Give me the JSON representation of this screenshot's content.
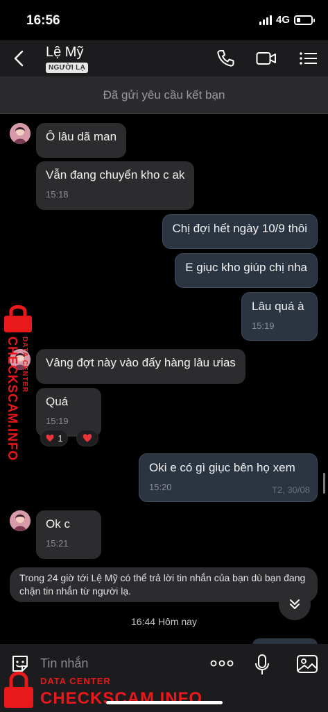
{
  "status": {
    "time": "16:56",
    "network": "4G"
  },
  "header": {
    "name": "Lệ Mỹ",
    "badge": "NGƯỜI LẠ"
  },
  "banner": "Đã gửi yêu cầu kết bạn",
  "messages": [
    {
      "dir": "in",
      "text": "Ô lâu dã man",
      "time": ""
    },
    {
      "dir": "in",
      "text": "Vẫn đang chuyển kho c ak",
      "time": "15:18"
    },
    {
      "dir": "out",
      "text": "Chị đợi hết ngày 10/9 thôi",
      "time": ""
    },
    {
      "dir": "out",
      "text": "E giục kho giúp chị nha",
      "time": ""
    },
    {
      "dir": "out",
      "text": "Lâu quá à",
      "time": "15:19"
    },
    {
      "dir": "in",
      "text": "Vâng đợt này vào đấy hàng lâu ưias",
      "time": ""
    },
    {
      "dir": "in",
      "text": "Quá",
      "time": "15:19",
      "reaction_count": "1"
    },
    {
      "dir": "out",
      "text": "Oki e có gì giục bên họ xem",
      "time": "15:20",
      "date": "T2, 30/08"
    },
    {
      "dir": "in",
      "text": "Ok c",
      "time": "15:21"
    }
  ],
  "notice": "Trong 24 giờ tới Lệ Mỹ có thể trả lời tin nhắn của bạn dù bạn đang chặn tin nhắn từ người lạ.",
  "day_divider": "16:44 Hôm nay",
  "input": {
    "placeholder": "Tin nhắn"
  },
  "watermark": {
    "small": "DATA CENTER",
    "big": "CHECKSCAM.INFO"
  },
  "colors": {
    "background": "#000000",
    "header": "#1c1c1e",
    "incoming_bubble": "#2c2c2e",
    "outgoing_bubble": "#2b3542",
    "watermark": "#e8181b"
  }
}
